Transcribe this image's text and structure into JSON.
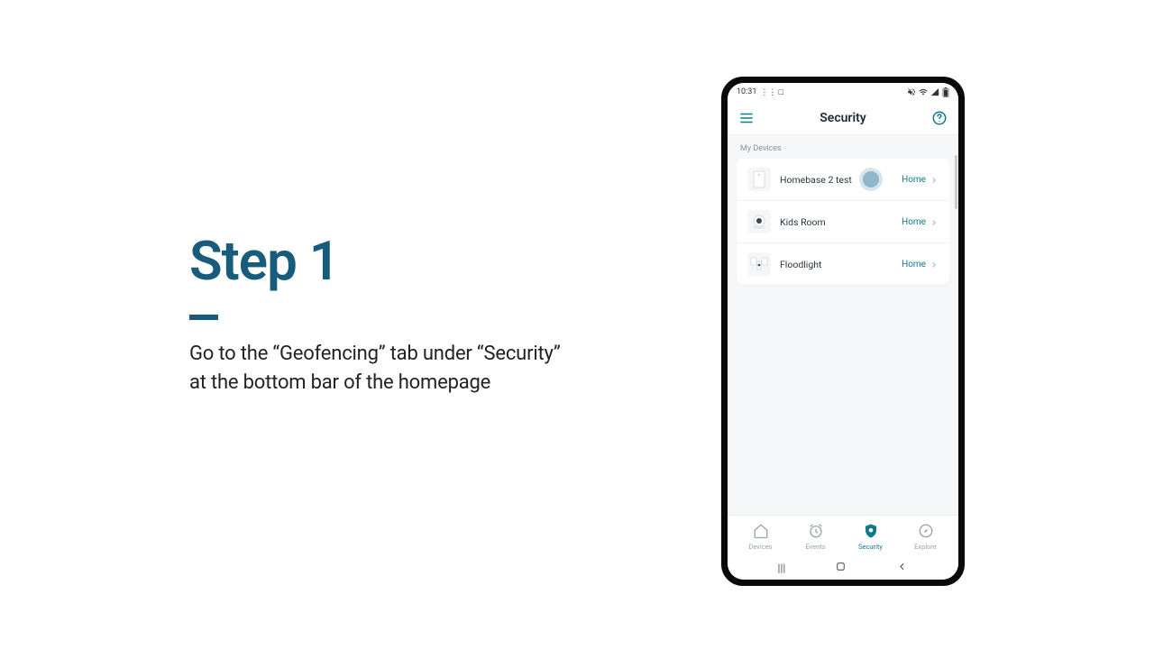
{
  "instructions": {
    "title": "Step 1",
    "body": "Go to the “Geofencing” tab under “Security” at the bottom bar of the homepage"
  },
  "statusbar": {
    "time": "10:31",
    "extra": "⋮⋮ □"
  },
  "header": {
    "title": "Security"
  },
  "section_label": "My Devices",
  "devices": [
    {
      "name": "Homebase 2 test",
      "status": "Home"
    },
    {
      "name": "Kids Room",
      "status": "Home"
    },
    {
      "name": "Floodlight",
      "status": "Home"
    }
  ],
  "tabs": [
    {
      "label": "Devices",
      "active": false
    },
    {
      "label": "Events",
      "active": false
    },
    {
      "label": "Security",
      "active": true
    },
    {
      "label": "Explore",
      "active": false
    }
  ],
  "colors": {
    "brand_text": "#175d7b",
    "accent": "#0f7a8e"
  }
}
